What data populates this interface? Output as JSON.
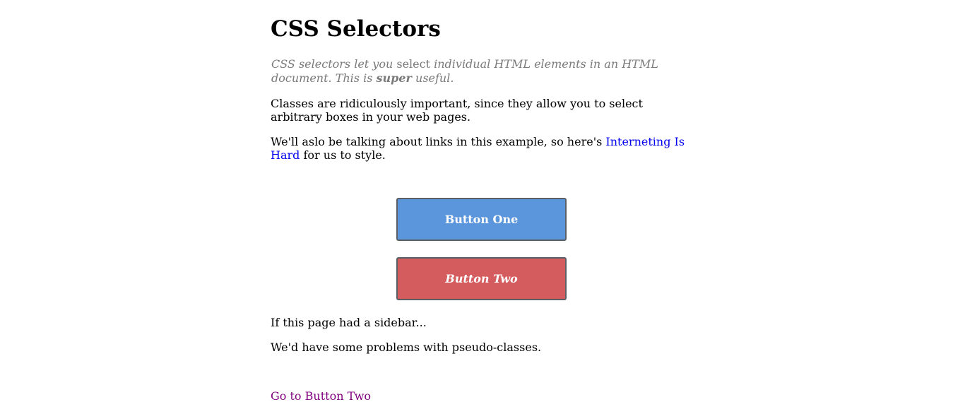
{
  "page": {
    "title": "CSS Selectors"
  },
  "synopsis": {
    "part1": "CSS selectors let you ",
    "part2": "select",
    "part3": " individual HTML elements in an HTML document. This is ",
    "part4": "super",
    "part5": " useful."
  },
  "paragraphs": {
    "classes": "Classes are ridiculously important, since they allow you to select arbitrary boxes in your web pages.",
    "links_before": "We'll aslo be talking about links in this example, so here's ",
    "links_link": "Interneting Is Hard",
    "links_after": " for us to style.",
    "sidebar": "If this page had a sidebar...",
    "pseudo": "We'd have some problems with pseudo-classes."
  },
  "buttons": {
    "one": "Button One",
    "two": "Button Two"
  },
  "footer": {
    "goto_link": "Go to Button Two"
  },
  "colors": {
    "button_one": "#5b96dc",
    "button_two": "#d55c5e",
    "link": "#0000ee",
    "visited_link": "#800080",
    "synopsis_text": "#7a7a7a"
  }
}
